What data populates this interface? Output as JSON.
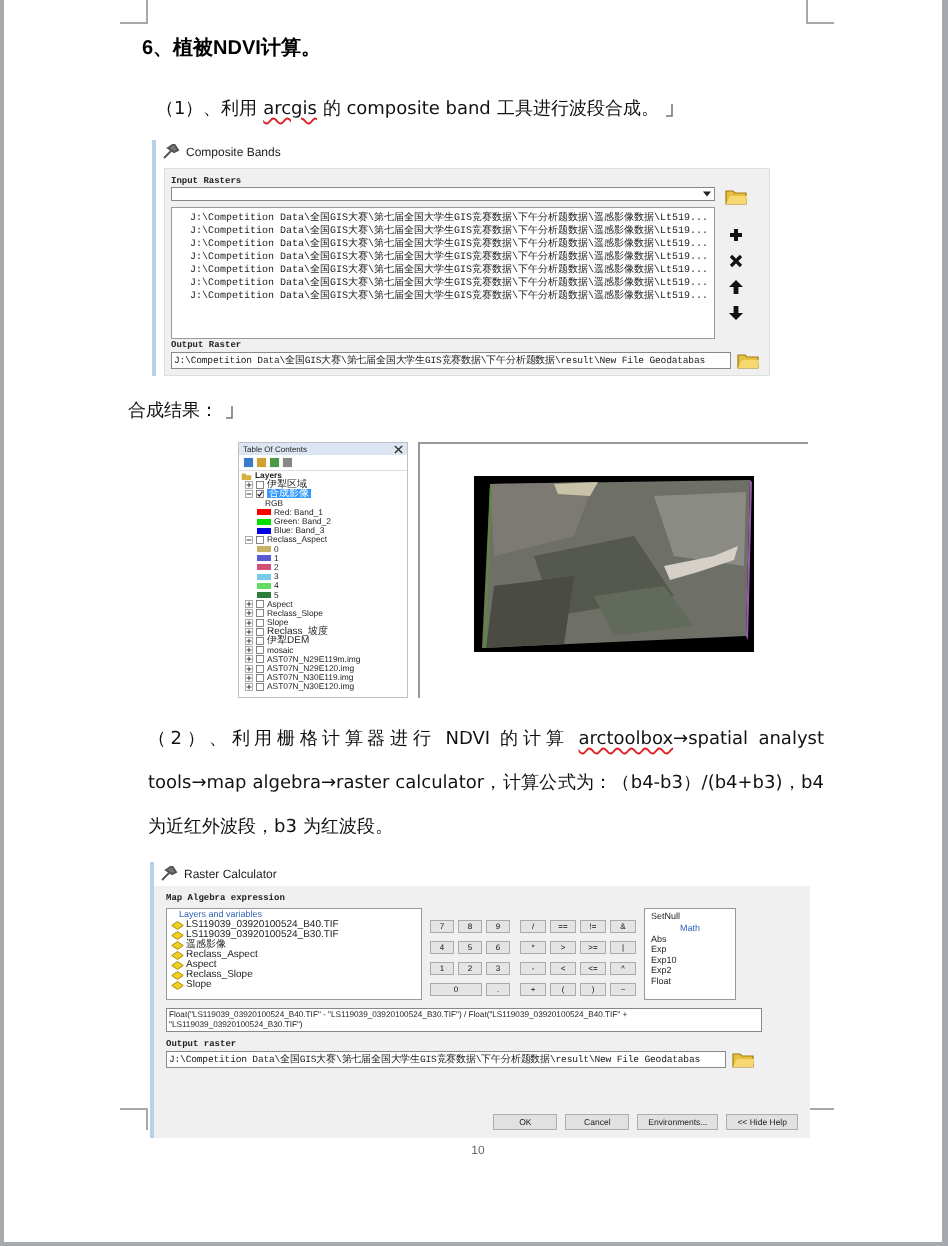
{
  "heading": "6、植被NDVI计算。",
  "paragraph_1": [
    {
      "text": "（1）、利用 ",
      "misspelled": false
    },
    {
      "text": "arcgis",
      "misspelled": true
    },
    {
      "text": " 的 composite band 工具进行波段合成。",
      "misspelled": false
    }
  ],
  "composite_bands": {
    "title": "Composite Bands",
    "input_label": "Input Rasters",
    "inputs": [
      "J:\\Competition Data\\全国GIS大赛\\第七届全国大学生GIS竞赛数据\\下午分析题数据\\遥感影像数据\\Lt519...",
      "J:\\Competition Data\\全国GIS大赛\\第七届全国大学生GIS竞赛数据\\下午分析题数据\\遥感影像数据\\Lt519...",
      "J:\\Competition Data\\全国GIS大赛\\第七届全国大学生GIS竞赛数据\\下午分析题数据\\遥感影像数据\\Lt519...",
      "J:\\Competition Data\\全国GIS大赛\\第七届全国大学生GIS竞赛数据\\下午分析题数据\\遥感影像数据\\Lt519...",
      "J:\\Competition Data\\全国GIS大赛\\第七届全国大学生GIS竞赛数据\\下午分析题数据\\遥感影像数据\\Lt519...",
      "J:\\Competition Data\\全国GIS大赛\\第七届全国大学生GIS竞赛数据\\下午分析题数据\\遥感影像数据\\Lt519...",
      "J:\\Competition Data\\全国GIS大赛\\第七届全国大学生GIS竞赛数据\\下午分析题数据\\遥感影像数据\\Lt519..."
    ],
    "output_label": "Output Raster",
    "output_value": "J:\\Competition Data\\全国GIS大赛\\第七届全国大学生GIS竞赛数据\\下午分析题数据\\result\\New File Geodatabas"
  },
  "result_label": "合成结果：",
  "table_of_contents": {
    "title": "Table Of Contents",
    "root": "Layers",
    "layers": [
      {
        "name": "伊犁区域",
        "checked": false,
        "selected": false,
        "expanded": false
      },
      {
        "name": "合成影像",
        "checked": true,
        "selected": true,
        "expanded": true,
        "renderer": "RGB",
        "legend": [
          {
            "label": "Red:   Band_1",
            "color": "#ff0000"
          },
          {
            "label": "Green: Band_2",
            "color": "#00e000"
          },
          {
            "label": "Blue:  Band_3",
            "color": "#0000e0"
          }
        ]
      },
      {
        "name": "Reclass_Aspect",
        "checked": false,
        "selected": false,
        "expanded": true,
        "legend": [
          {
            "label": "0",
            "color": "#c8b464"
          },
          {
            "label": "1",
            "color": "#5a5ad2"
          },
          {
            "label": "2",
            "color": "#d25078"
          },
          {
            "label": "3",
            "color": "#78c8e6"
          },
          {
            "label": "4",
            "color": "#64dc64"
          },
          {
            "label": "5",
            "color": "#2d7d3c"
          }
        ]
      },
      {
        "name": "Aspect",
        "checked": false,
        "selected": false,
        "expanded": false
      },
      {
        "name": "Reclass_Slope",
        "checked": false,
        "selected": false,
        "expanded": false
      },
      {
        "name": "Slope",
        "checked": false,
        "selected": false,
        "expanded": false
      },
      {
        "name": "Reclass_坡度",
        "checked": false,
        "selected": false,
        "expanded": false
      },
      {
        "name": "伊犁DEM",
        "checked": false,
        "selected": false,
        "expanded": false
      },
      {
        "name": "mosaic",
        "checked": false,
        "selected": false,
        "expanded": false
      },
      {
        "name": "AST07N_N29E119m.img",
        "checked": false,
        "selected": false,
        "expanded": false
      },
      {
        "name": "AST07N_N29E120.img",
        "checked": false,
        "selected": false,
        "expanded": false
      },
      {
        "name": "AST07N_N30E119.img",
        "checked": false,
        "selected": false,
        "expanded": false
      },
      {
        "name": "AST07N_N30E120.img",
        "checked": false,
        "selected": false,
        "expanded": false
      }
    ]
  },
  "paragraph_2": [
    {
      "text": "（2）、利用栅格计算器进行 NDVI 的计算 ",
      "misspelled": false
    },
    {
      "text": "arctoolbox",
      "misspelled": true
    },
    {
      "text": "→spatial analyst tools→map algebra→raster calculator，计算公式为：（b4-b3）/(b4+b3)，b4 为近红外波段，b3 为红波段。",
      "misspelled": false
    }
  ],
  "raster_calculator": {
    "title": "Raster Calculator",
    "expression_label": "Map Algebra expression",
    "layers_header": "Layers and variables",
    "layers": [
      "LS119039_03920100524_B40.TIF",
      "LS119039_03920100524_B30.TIF",
      "遥感影像",
      "Reclass_Aspect",
      "Aspect",
      "Reclass_Slope",
      "Slope"
    ],
    "digit_keys": [
      [
        "7",
        "8",
        "9"
      ],
      [
        "4",
        "5",
        "6"
      ],
      [
        "1",
        "2",
        "3"
      ],
      [
        "0",
        "."
      ]
    ],
    "operator_keys": [
      [
        "/",
        "==",
        "!=",
        "&"
      ],
      [
        "*",
        ">",
        ">=",
        "|"
      ],
      [
        "-",
        "<",
        "<=",
        "^"
      ],
      [
        "+",
        "(",
        ")",
        "~"
      ]
    ],
    "functions": [
      {
        "text": "SetNull",
        "kind": "item"
      },
      {
        "text": "Math",
        "kind": "header"
      },
      {
        "text": "Abs",
        "kind": "item"
      },
      {
        "text": "Exp",
        "kind": "item"
      },
      {
        "text": "Exp10",
        "kind": "item"
      },
      {
        "text": "Exp2",
        "kind": "item"
      },
      {
        "text": "Float",
        "kind": "item"
      }
    ],
    "expression": "Float(\"LS119039_03920100524_B40.TIF\" - \"LS119039_03920100524_B30.TIF\") / Float(\"LS119039_03920100524_B40.TIF\" + \"LS119039_03920100524_B30.TIF\")",
    "output_label": "Output raster",
    "output_value": "J:\\Competition Data\\全国GIS大赛\\第七届全国大学生GIS竞赛数据\\下午分析题数据\\result\\New File Geodatabas",
    "buttons": [
      "OK",
      "Cancel",
      "Environments...",
      "<< Hide Help"
    ]
  },
  "page_number": "10"
}
